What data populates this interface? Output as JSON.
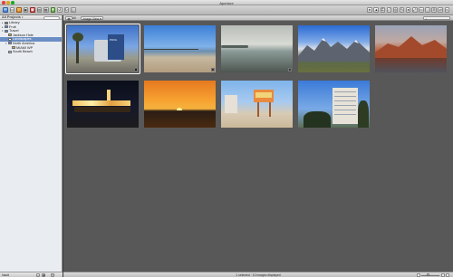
{
  "window": {
    "title": "Aperture"
  },
  "sidebar": {
    "header": "All Projects",
    "items": [
      {
        "label": "Library",
        "icon": "library-icon",
        "icon_color": "#7a7a7a",
        "expand": "▸",
        "depth": 0,
        "selected": false
      },
      {
        "label": "Fruit",
        "icon": "folder-icon",
        "icon_color": "#4a8fe6",
        "expand": "▸",
        "depth": 0,
        "selected": false
      },
      {
        "label": "Travel",
        "icon": "folder-icon",
        "icon_color": "#4a8fe6",
        "expand": "▾",
        "depth": 0,
        "selected": false
      },
      {
        "label": "Jackson Hole",
        "icon": "project-icon",
        "icon_color": "#cfa55a",
        "expand": "",
        "depth": 1,
        "selected": false
      },
      {
        "label": "Landscapes",
        "icon": "album-icon",
        "icon_color": "#ffffff",
        "expand": "",
        "depth": 1,
        "selected": true
      },
      {
        "label": "North America",
        "icon": "folder-icon",
        "icon_color": "#4a8fe6",
        "expand": "▾",
        "depth": 1,
        "selected": false
      },
      {
        "label": "MIAMI WP",
        "icon": "project-icon",
        "icon_color": "#cfa55a",
        "expand": "",
        "depth": 2,
        "selected": false
      },
      {
        "label": "South Beach",
        "icon": "album-icon",
        "icon_color": "#9bb7d6",
        "expand": "",
        "depth": 1,
        "selected": false
      }
    ],
    "footer_label": "Vault"
  },
  "browser": {
    "view_label": "Image View",
    "filter_label": "All"
  },
  "status_text": "1 selected · 10 images displayed",
  "slider_value": 0.35,
  "thumbnails": [
    {
      "name": "thumb-pool-building",
      "caption": "",
      "badge": "",
      "stack": "",
      "selected": true
    },
    {
      "name": "thumb-pier-beach",
      "caption": "",
      "badge": "▪",
      "stack": "",
      "selected": false
    },
    {
      "name": "thumb-calm-shore",
      "caption": "",
      "badge": "▪",
      "stack": "",
      "selected": false
    },
    {
      "name": "thumb-mountain-range",
      "caption": "",
      "badge": "",
      "stack": "",
      "selected": false
    },
    {
      "name": "thumb-sunset-peaks",
      "caption": "",
      "badge": "",
      "stack": "",
      "selected": false
    },
    {
      "name": "thumb-night-pier",
      "caption": "",
      "badge": "",
      "stack": "",
      "selected": false
    },
    {
      "name": "thumb-orange-sunset",
      "caption": "",
      "badge": "",
      "stack": "",
      "selected": false
    },
    {
      "name": "thumb-lifeguard-tower",
      "caption": "",
      "badge": "",
      "stack": "",
      "selected": false
    },
    {
      "name": "thumb-hotel-palms",
      "caption": "",
      "badge": "",
      "stack": "",
      "selected": false
    }
  ]
}
